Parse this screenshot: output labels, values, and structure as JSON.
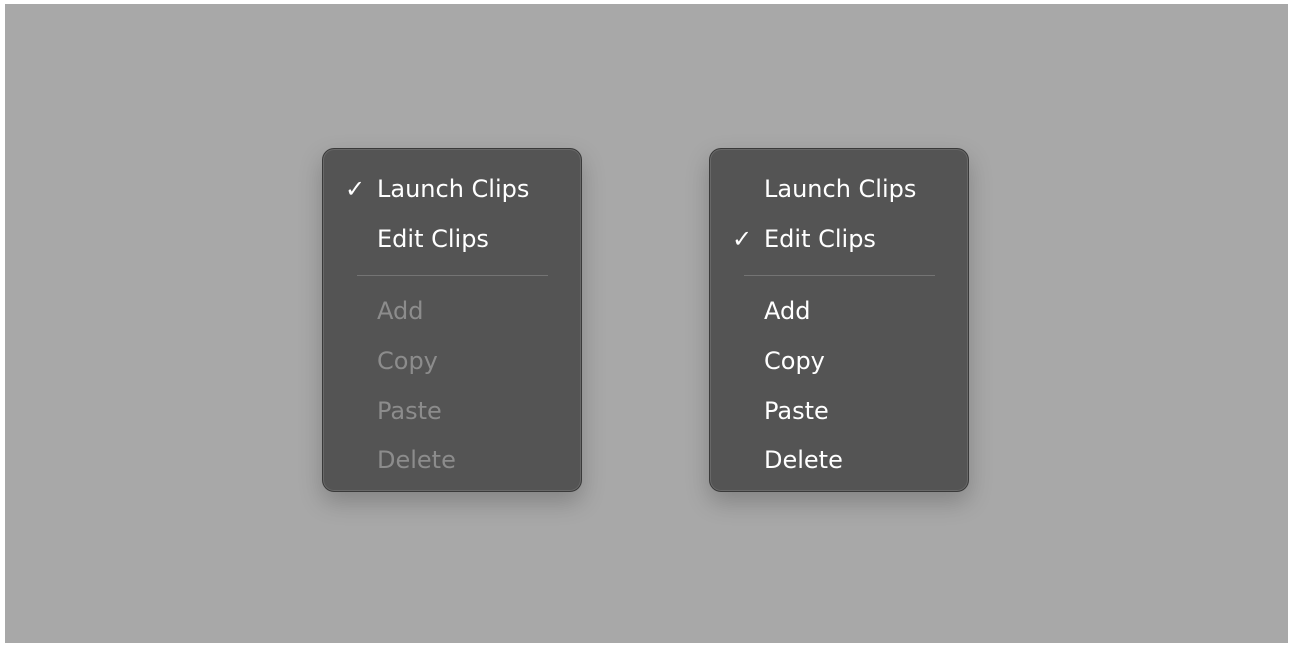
{
  "menus": [
    {
      "items_top": [
        {
          "label": "Launch Clips",
          "check": "✓"
        },
        {
          "label": "Edit Clips",
          "check": ""
        }
      ],
      "items_bottom": [
        {
          "label": "Add"
        },
        {
          "label": "Copy"
        },
        {
          "label": "Paste"
        },
        {
          "label": "Delete"
        }
      ],
      "bottom_disabled": true
    },
    {
      "items_top": [
        {
          "label": "Launch Clips",
          "check": ""
        },
        {
          "label": "Edit Clips",
          "check": "✓"
        }
      ],
      "items_bottom": [
        {
          "label": "Add"
        },
        {
          "label": "Copy"
        },
        {
          "label": "Paste"
        },
        {
          "label": "Delete"
        }
      ],
      "bottom_disabled": false
    }
  ]
}
